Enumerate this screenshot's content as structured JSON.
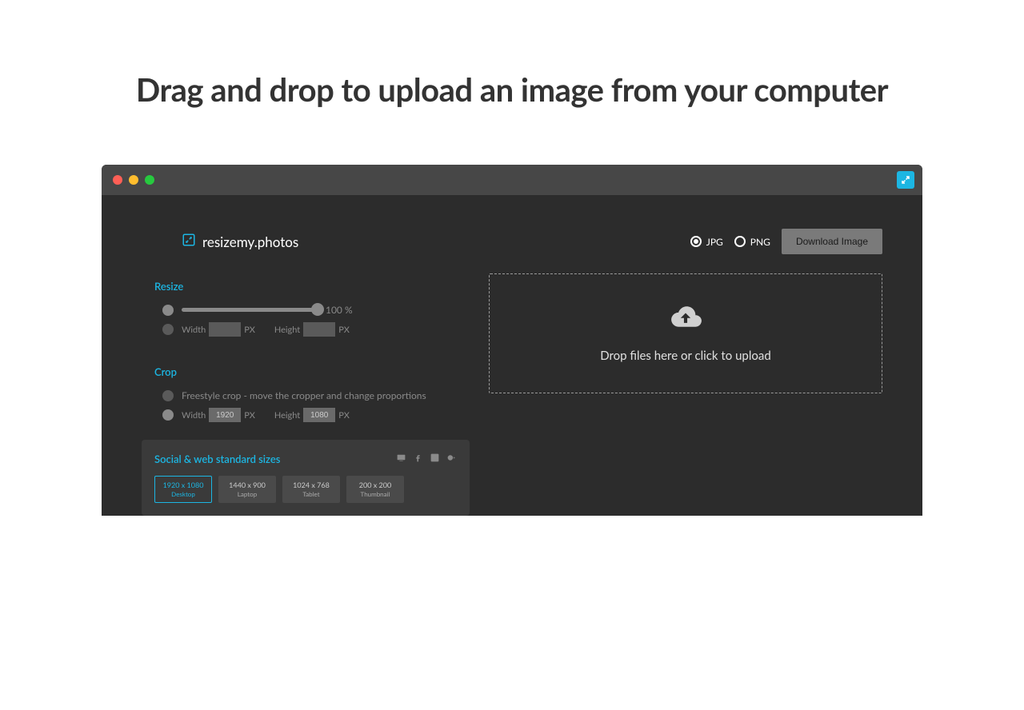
{
  "title": "Drag and drop to upload an image from your computer",
  "brand": "resizemy.photos",
  "formats": {
    "jpg": "JPG",
    "png": "PNG",
    "selected": "jpg"
  },
  "download_label": "Download Image",
  "resize": {
    "label": "Resize",
    "percent": "100 %",
    "width_label": "Width",
    "height_label": "Height",
    "px": "PX",
    "width_value": "",
    "height_value": ""
  },
  "crop": {
    "label": "Crop",
    "freestyle": "Freestyle crop - move the cropper and change proportions",
    "width_label": "Width",
    "height_label": "Height",
    "px": "PX",
    "width_value": "1920",
    "height_value": "1080"
  },
  "sizes": {
    "title": "Social & web standard sizes",
    "tiles": [
      {
        "dim": "1920 x 1080",
        "name": "Desktop",
        "active": true
      },
      {
        "dim": "1440 x 900",
        "name": "Laptop",
        "active": false
      },
      {
        "dim": "1024 x 768",
        "name": "Tablet",
        "active": false
      },
      {
        "dim": "200 x 200",
        "name": "Thumbnail",
        "active": false
      }
    ]
  },
  "dropzone": "Drop files here or click to upload"
}
